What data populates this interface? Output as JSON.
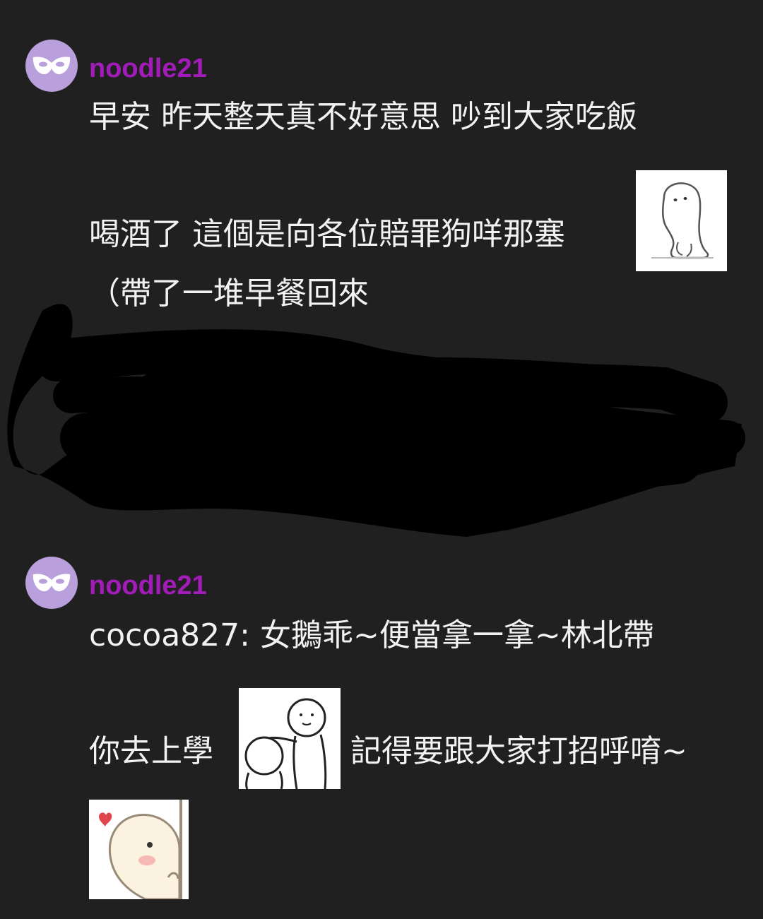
{
  "messages": [
    {
      "username": "noodle21",
      "lines": [
        "早安 昨天整天真不好意思 吵到大家吃飯",
        "喝酒了 這個是向各位賠罪狗咩那塞",
        "（帶了一堆早餐回來"
      ],
      "stickers": [
        "ghost-sitting-sticker"
      ]
    },
    {
      "username": "noodle21",
      "lines": [
        "cocoa827: 女鵝乖~便當拿一拿~林北帶",
        "你去上學",
        "記得要跟大家打招呼唷~"
      ],
      "stickers": [
        "two-figures-pat-sticker",
        "peeking-blob-heart-sticker"
      ]
    }
  ],
  "colors": {
    "background": "#202020",
    "username": "#a31bb8",
    "avatar": "#b9a0dc",
    "text": "#f2f2f2"
  },
  "icons": [
    "mask-icon"
  ]
}
